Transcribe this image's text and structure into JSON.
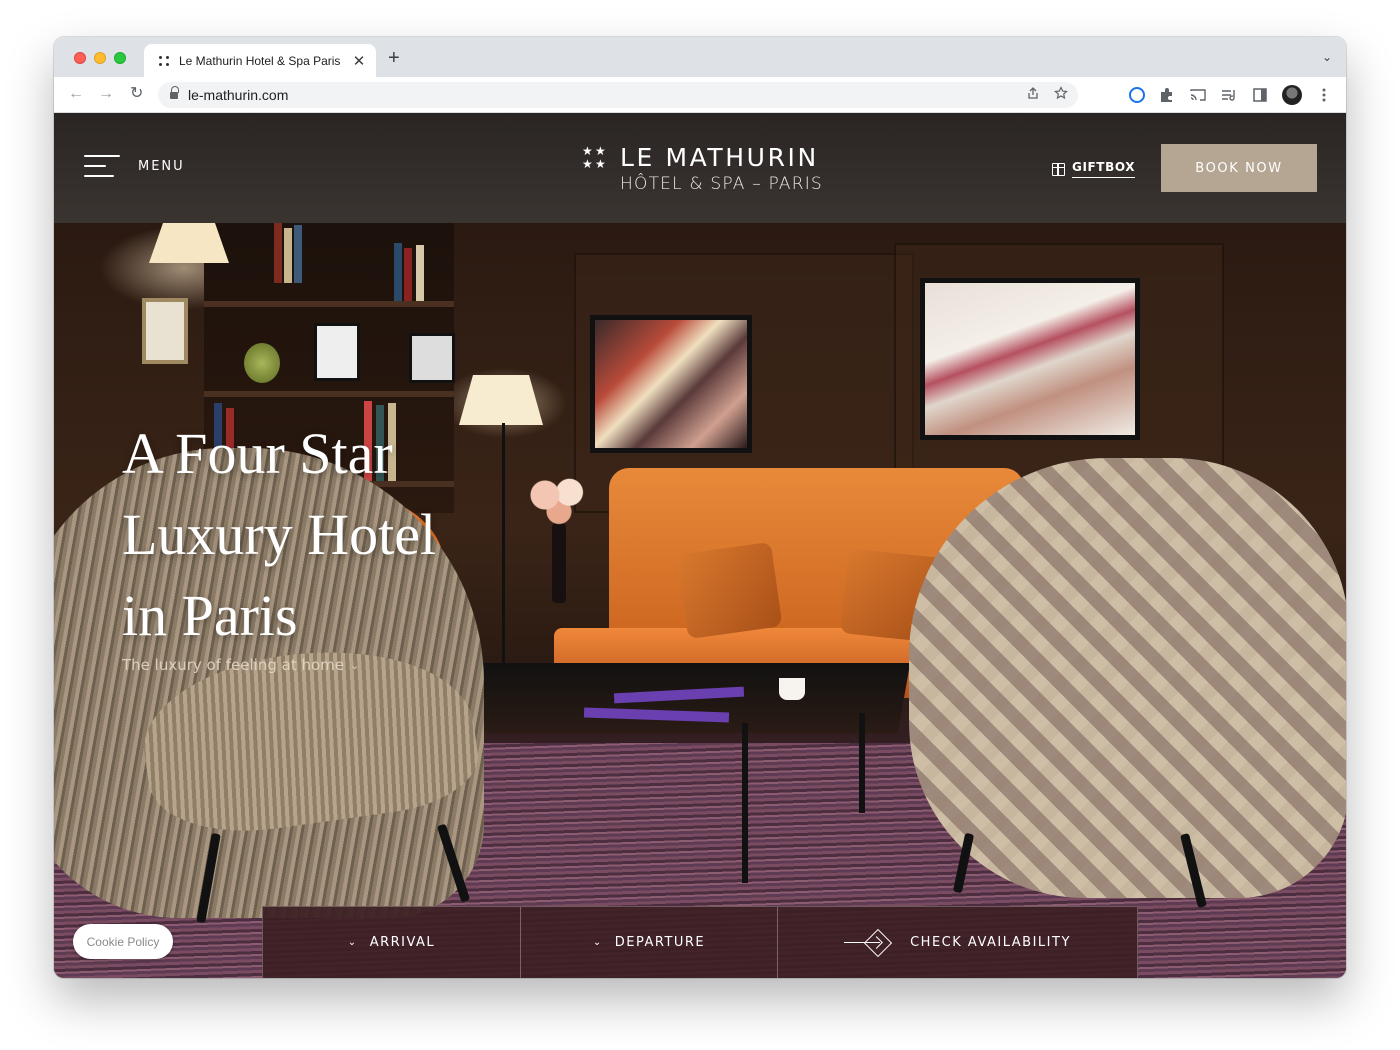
{
  "browser": {
    "tab_title": "Le Mathurin Hotel & Spa Paris",
    "tab_close": "✕",
    "new_tab": "+",
    "tab_menu": "⌄",
    "url": "le-mathurin.com",
    "nav": {
      "back": "←",
      "forward": "→",
      "reload": "↻"
    },
    "omnibox_icons": [
      "share-icon",
      "star-icon"
    ],
    "toolbar_icons": [
      "extension-ring-icon",
      "puzzle-icon",
      "cast-icon",
      "media-icon",
      "side-panel-icon",
      "avatar",
      "more-vert-icon"
    ]
  },
  "header": {
    "menu_label": "MENU",
    "logo_name": "LE MATHURIN",
    "logo_sub": "HÔTEL & SPA – PARIS",
    "giftbox_label": "GIFTBOX",
    "book_now_label": "BOOK NOW"
  },
  "hero": {
    "title": "A Four Star\nLuxury Hotel\nin Paris",
    "subtitle": "The luxury of feeling at home",
    "subtitle_chev": "⌄"
  },
  "booking": {
    "arrival_label": "ARRIVAL",
    "departure_label": "DEPARTURE",
    "check_label": "CHECK AVAILABILITY",
    "chev": "⌄"
  },
  "cookie_label": "Cookie Policy",
  "colors": {
    "header_bg": "#2e2826",
    "book_now_bg": "#b5a693",
    "booking_bar_bg": "#3c2024",
    "chrome_tabstrip": "#dee1e6"
  }
}
